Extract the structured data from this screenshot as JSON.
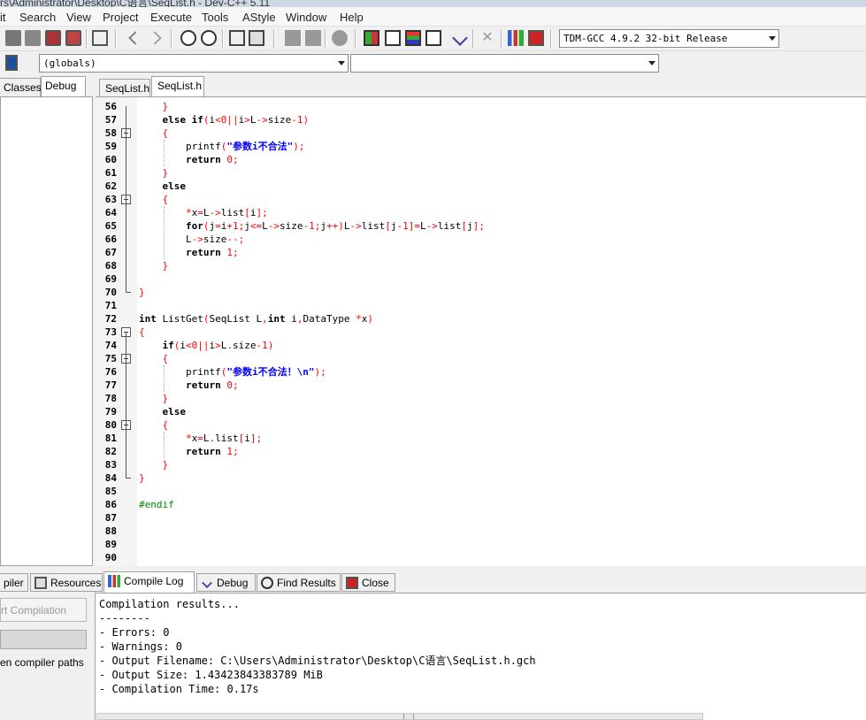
{
  "window": {
    "title": "rs\\Administrator\\Desktop\\C语言\\SeqList.h - Dev-C++ 5.11"
  },
  "menu": [
    "it",
    "Search",
    "View",
    "Project",
    "Execute",
    "Tools",
    "AStyle",
    "Window",
    "Help"
  ],
  "toolbar": {
    "compiler": "TDM-GCC 4.9.2 32-bit Release"
  },
  "combos": {
    "scope": "(globals)",
    "members": ""
  },
  "left_tabs": [
    "Classes",
    "Debug"
  ],
  "editor_tabs": [
    "SeqList.h",
    "SeqList.h"
  ],
  "code_lines": [
    {
      "n": "56",
      "t": "    }"
    },
    {
      "n": "57",
      "t": "    else if(i<0||i>L->size-1)"
    },
    {
      "n": "58",
      "t": "    {"
    },
    {
      "n": "59",
      "t": "        printf(\"参数i不合法\");"
    },
    {
      "n": "60",
      "t": "        return 0;"
    },
    {
      "n": "61",
      "t": "    }"
    },
    {
      "n": "62",
      "t": "    else"
    },
    {
      "n": "63",
      "t": "    {"
    },
    {
      "n": "64",
      "t": "        *x=L->list[i];"
    },
    {
      "n": "65",
      "t": "        for(j=i+1;j<=L->size-1;j++)L->list[j-1]=L->list[j];"
    },
    {
      "n": "66",
      "t": "        L->size--;"
    },
    {
      "n": "67",
      "t": "        return 1;"
    },
    {
      "n": "68",
      "t": "    }"
    },
    {
      "n": "69",
      "t": ""
    },
    {
      "n": "70",
      "t": "}"
    },
    {
      "n": "71",
      "t": ""
    },
    {
      "n": "72",
      "t": "int ListGet(SeqList L,int i,DataType *x)"
    },
    {
      "n": "73",
      "t": "{"
    },
    {
      "n": "74",
      "t": "    if(i<0||i>L.size-1)"
    },
    {
      "n": "75",
      "t": "    {"
    },
    {
      "n": "76",
      "t": "        printf(\"参数i不合法！\\n\");"
    },
    {
      "n": "77",
      "t": "        return 0;"
    },
    {
      "n": "78",
      "t": "    }"
    },
    {
      "n": "79",
      "t": "    else"
    },
    {
      "n": "80",
      "t": "    {"
    },
    {
      "n": "81",
      "t": "        *x=L.list[i];"
    },
    {
      "n": "82",
      "t": "        return 1;"
    },
    {
      "n": "83",
      "t": "    }"
    },
    {
      "n": "84",
      "t": "}"
    },
    {
      "n": "85",
      "t": ""
    },
    {
      "n": "86",
      "t": "#endif"
    },
    {
      "n": "87",
      "t": ""
    },
    {
      "n": "88",
      "t": ""
    },
    {
      "n": "89",
      "t": ""
    },
    {
      "n": "90",
      "t": ""
    }
  ],
  "fold_lines": [
    "58",
    "63",
    "73",
    "75",
    "80"
  ],
  "bottom_tabs": [
    "piler",
    "Resources",
    "Compile Log",
    "Debug",
    "Find Results",
    "Close"
  ],
  "bottom_left": {
    "abort_button": "rt Compilation",
    "shorten_paths": "en compiler paths"
  },
  "compile_log": [
    "Compilation results...",
    "--------",
    "- Errors: 0",
    "- Warnings: 0",
    "- Output Filename: C:\\Users\\Administrator\\Desktop\\C语言\\SeqList.h.gch",
    "- Output Size: 1.43423843383789 MiB",
    "- Compilation Time: 0.17s"
  ],
  "colors": {
    "keyword": "#000000",
    "symbol": "#ff0000",
    "string": "#0000ff",
    "preprocessor": "#008000",
    "line_numbers": "#000000"
  }
}
